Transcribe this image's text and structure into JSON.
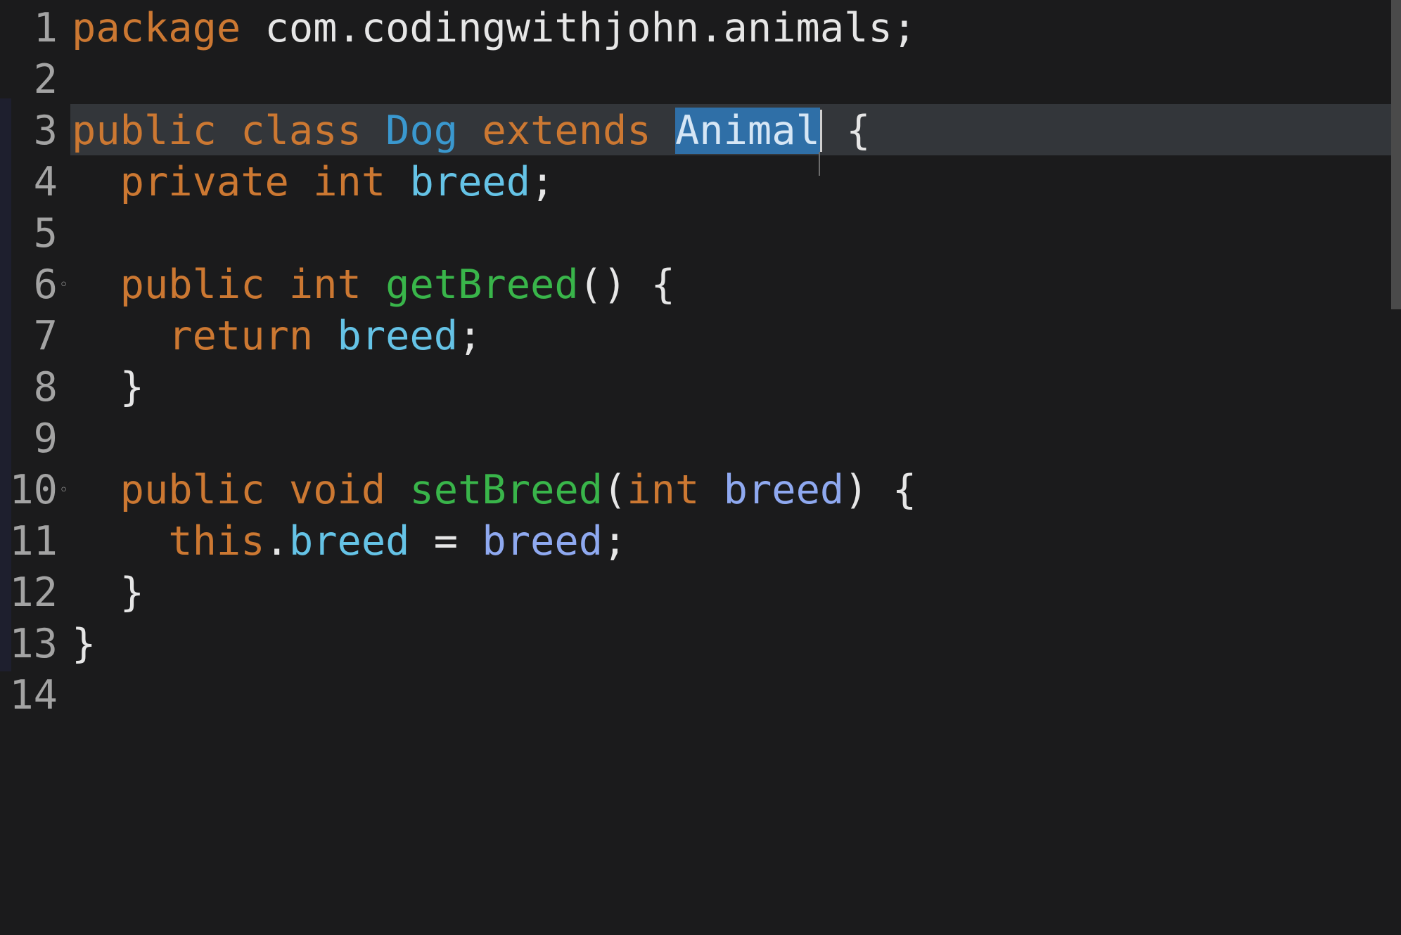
{
  "editor": {
    "lines": [
      {
        "n": "1",
        "fold": "",
        "tokens": [
          {
            "t": "package",
            "c": "kw"
          },
          {
            "t": " com.codingwithjohn.animals;",
            "c": "plain"
          }
        ]
      },
      {
        "n": "2",
        "fold": "",
        "tokens": []
      },
      {
        "n": "3",
        "fold": "",
        "tokens": [
          {
            "t": "public",
            "c": "kw"
          },
          {
            "t": " ",
            "c": "plain"
          },
          {
            "t": "class",
            "c": "kw"
          },
          {
            "t": " ",
            "c": "plain"
          },
          {
            "t": "Dog",
            "c": "type"
          },
          {
            "t": " ",
            "c": "plain"
          },
          {
            "t": "extends",
            "c": "kw"
          },
          {
            "t": " ",
            "c": "plain"
          },
          {
            "t": "Animal",
            "c": "sel"
          },
          {
            "t": "",
            "c": "caret"
          },
          {
            "t": " {",
            "c": "plain"
          }
        ]
      },
      {
        "n": "4",
        "fold": "",
        "tokens": [
          {
            "t": "  private",
            "c": "kw"
          },
          {
            "t": " ",
            "c": "plain"
          },
          {
            "t": "int",
            "c": "kw"
          },
          {
            "t": " ",
            "c": "plain"
          },
          {
            "t": "breed",
            "c": "field"
          },
          {
            "t": ";",
            "c": "plain"
          }
        ]
      },
      {
        "n": "5",
        "fold": "",
        "tokens": []
      },
      {
        "n": "6",
        "fold": "◦",
        "tokens": [
          {
            "t": "  public",
            "c": "kw"
          },
          {
            "t": " ",
            "c": "plain"
          },
          {
            "t": "int",
            "c": "kw"
          },
          {
            "t": " ",
            "c": "plain"
          },
          {
            "t": "getBreed",
            "c": "method"
          },
          {
            "t": "() {",
            "c": "plain"
          }
        ]
      },
      {
        "n": "7",
        "fold": "",
        "tokens": [
          {
            "t": "    return",
            "c": "kw"
          },
          {
            "t": " ",
            "c": "plain"
          },
          {
            "t": "breed",
            "c": "field"
          },
          {
            "t": ";",
            "c": "plain"
          }
        ]
      },
      {
        "n": "8",
        "fold": "",
        "tokens": [
          {
            "t": "  }",
            "c": "plain"
          }
        ]
      },
      {
        "n": "9",
        "fold": "",
        "tokens": []
      },
      {
        "n": "10",
        "fold": "◦",
        "tokens": [
          {
            "t": "  public",
            "c": "kw"
          },
          {
            "t": " ",
            "c": "plain"
          },
          {
            "t": "void",
            "c": "kw"
          },
          {
            "t": " ",
            "c": "plain"
          },
          {
            "t": "setBreed",
            "c": "method"
          },
          {
            "t": "(",
            "c": "plain"
          },
          {
            "t": "int",
            "c": "kw"
          },
          {
            "t": " ",
            "c": "plain"
          },
          {
            "t": "breed",
            "c": "param"
          },
          {
            "t": ") {",
            "c": "plain"
          }
        ]
      },
      {
        "n": "11",
        "fold": "",
        "tokens": [
          {
            "t": "    this",
            "c": "kw"
          },
          {
            "t": ".",
            "c": "plain"
          },
          {
            "t": "breed",
            "c": "field"
          },
          {
            "t": " = ",
            "c": "plain"
          },
          {
            "t": "breed",
            "c": "param"
          },
          {
            "t": ";",
            "c": "plain"
          }
        ]
      },
      {
        "n": "12",
        "fold": "",
        "tokens": [
          {
            "t": "  }",
            "c": "plain"
          }
        ]
      },
      {
        "n": "13",
        "fold": "",
        "tokens": [
          {
            "t": "}",
            "c": "plain"
          }
        ]
      },
      {
        "n": "14",
        "fold": "",
        "tokens": []
      }
    ],
    "active_line": "3",
    "selected_text": "Animal",
    "colors": {
      "background": "#1b1b1c",
      "keyword": "#cc7832",
      "type": "#3a98cf",
      "method": "#39b54a",
      "field": "#65c3e6",
      "param": "#8fa9f0",
      "selection": "#2f6fa7",
      "current_line": "#33363a"
    }
  }
}
